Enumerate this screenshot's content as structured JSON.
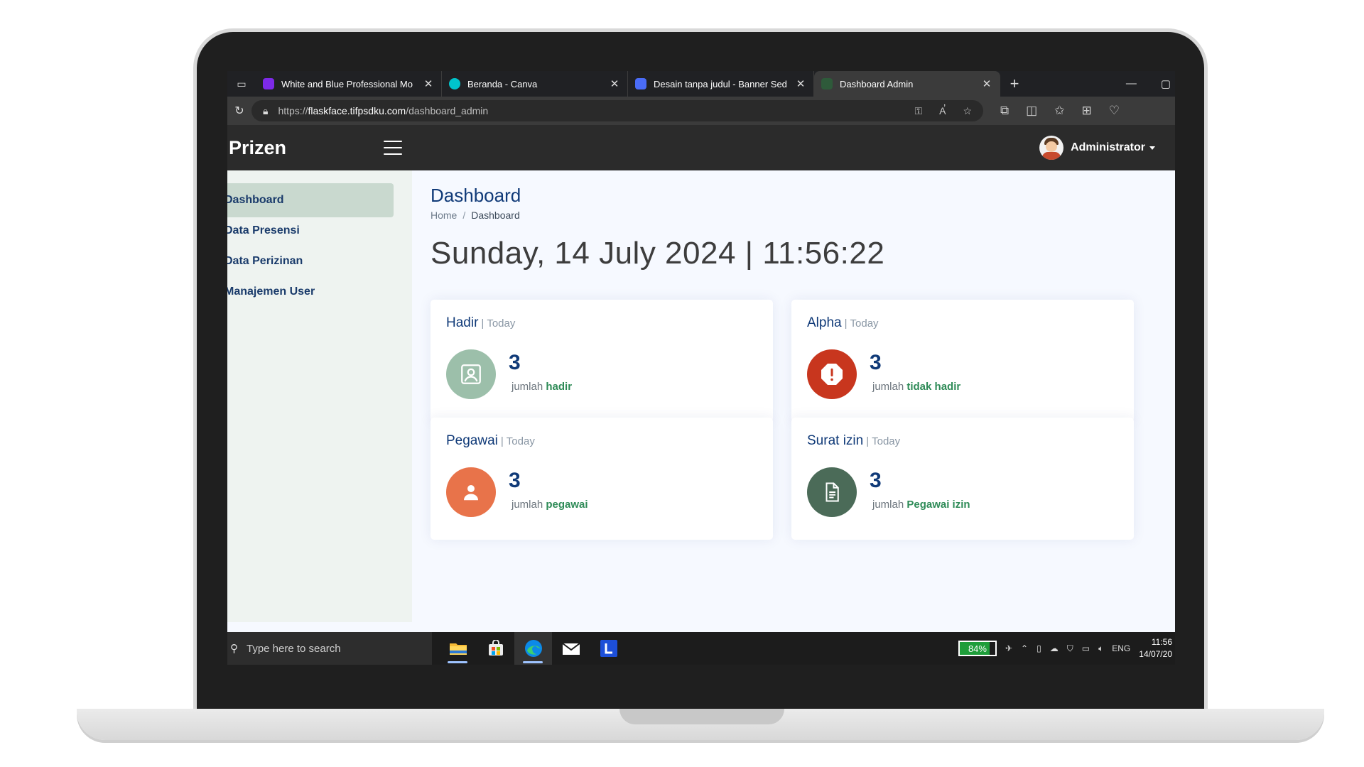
{
  "browser": {
    "tabs": [
      {
        "title": "White and Blue Professional Mo",
        "favicon_color": "#7d2ae8",
        "active": false
      },
      {
        "title": "Beranda - Canva",
        "favicon_color": "#00c4cc",
        "active": false
      },
      {
        "title": "Desain tanpa judul - Banner Sed",
        "favicon_color": "#4a6cf7",
        "active": false
      },
      {
        "title": "Dashboard Admin",
        "favicon_color": "#2e5a3a",
        "active": true
      }
    ],
    "url_scheme": "https://",
    "url_host": "flaskface.tifpsdku.com",
    "url_path": "/dashboard_admin"
  },
  "app": {
    "logo": "Prizen",
    "user_name": "Administrator"
  },
  "sidebar": {
    "items": [
      {
        "label": "Dashboard",
        "active": true
      },
      {
        "label": "Data Presensi",
        "active": false
      },
      {
        "label": "Data Perizinan",
        "active": false
      },
      {
        "label": "Manajemen User",
        "active": false
      }
    ]
  },
  "main": {
    "title": "Dashboard",
    "breadcrumb": {
      "home": "Home",
      "separator": "/",
      "current": "Dashboard"
    },
    "datetime": "Sunday, 14 July 2024 | 11:56:22",
    "cards": [
      {
        "title": "Hadir",
        "period": "Today",
        "value": "3",
        "desc_prefix": "jumlah",
        "desc_em": "hadir",
        "icon": "person-frame-icon",
        "icon_color": "#9cbfaa"
      },
      {
        "title": "Alpha",
        "period": "Today",
        "value": "3",
        "desc_prefix": "jumlah",
        "desc_em": "tidak hadir",
        "icon": "alert-octagon-icon",
        "icon_color": "#c8361e"
      },
      {
        "title": "Pegawai",
        "period": "Today",
        "value": "3",
        "desc_prefix": "jumlah",
        "desc_em": "pegawai",
        "icon": "person-icon",
        "icon_color": "#e8734a"
      },
      {
        "title": "Surat izin",
        "period": "Today",
        "value": "3",
        "desc_prefix": "jumlah",
        "desc_em": "Pegawai izin",
        "icon": "document-icon",
        "icon_color": "#4b6b58"
      }
    ]
  },
  "taskbar": {
    "search_placeholder": "Type here to search",
    "battery": "84%",
    "battery_level": 0.84,
    "language": "ENG",
    "time": "11:56",
    "date": "14/07/20"
  }
}
